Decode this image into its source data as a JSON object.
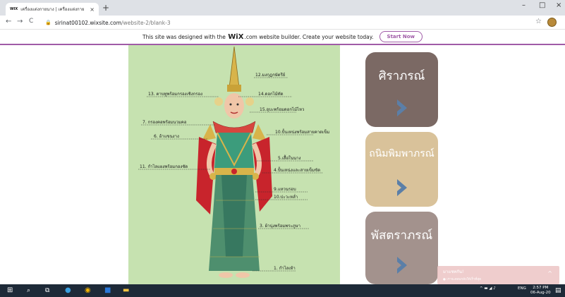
{
  "browser": {
    "tab_favicon": "WIX",
    "tab_title": "เครื่องแต่งกายนาง | เครื่องแต่งกาย",
    "tab_close": "×",
    "new_tab": "+",
    "url_host": "sirinat00102.wixsite.com",
    "url_path": "/website-2/blank-3",
    "nav_back": "←",
    "nav_forward": "→",
    "nav_reload": "C",
    "star": "☆",
    "minimize": "–",
    "maximize": "□",
    "close": "×"
  },
  "wix_banner": {
    "text_before": "This site was designed with the",
    "brand": "WiX",
    "text_after": ".com website builder. Create your website today.",
    "button": "Start Now",
    "accent": "#a05ba7"
  },
  "costume_labels": [
    "12.มงกุฎกษัตรีย์",
    "13. ตาบทูพร้อมกรองเชิงกรอง",
    "14.ดอกไม้ทัด",
    "15.อุบะพร้อมดอกไม้ไหว",
    "7. กรองคอพร้อมนวมคอ",
    "6. อ้าแขนงาง",
    "10.ปั้นเหน่งพร้อมสายคาดเข็ม",
    "5.เสื้อในนาง",
    "11. กำไลแผงพร้อมกองซัด",
    "4.ปั้นเหน่งและสายเข็มขัด",
    "9.แหวนรอบ",
    "10.ปะวะหล่ำ",
    "3. ผ้านุ่งพร้อมพระภูษา",
    "1. กำไลเท้า"
  ],
  "cards": [
    {
      "title": "ศิราภรณ์",
      "color": "#7b6964"
    },
    {
      "title": "ถนิมพิมพาภรณ์",
      "color": "#d9c29a"
    },
    {
      "title": "พัสตราภรณ์",
      "color": "#a3928d"
    }
  ],
  "chevron_color": "#5b7fa8",
  "toast": {
    "title": "มาแชทกัน!",
    "subtitle": "● เราจะตอบกลับให้เร็วที่สุด"
  },
  "taskbar": {
    "lang": "ENG",
    "time": "2:57 PM",
    "date": "06-Aug-20"
  }
}
